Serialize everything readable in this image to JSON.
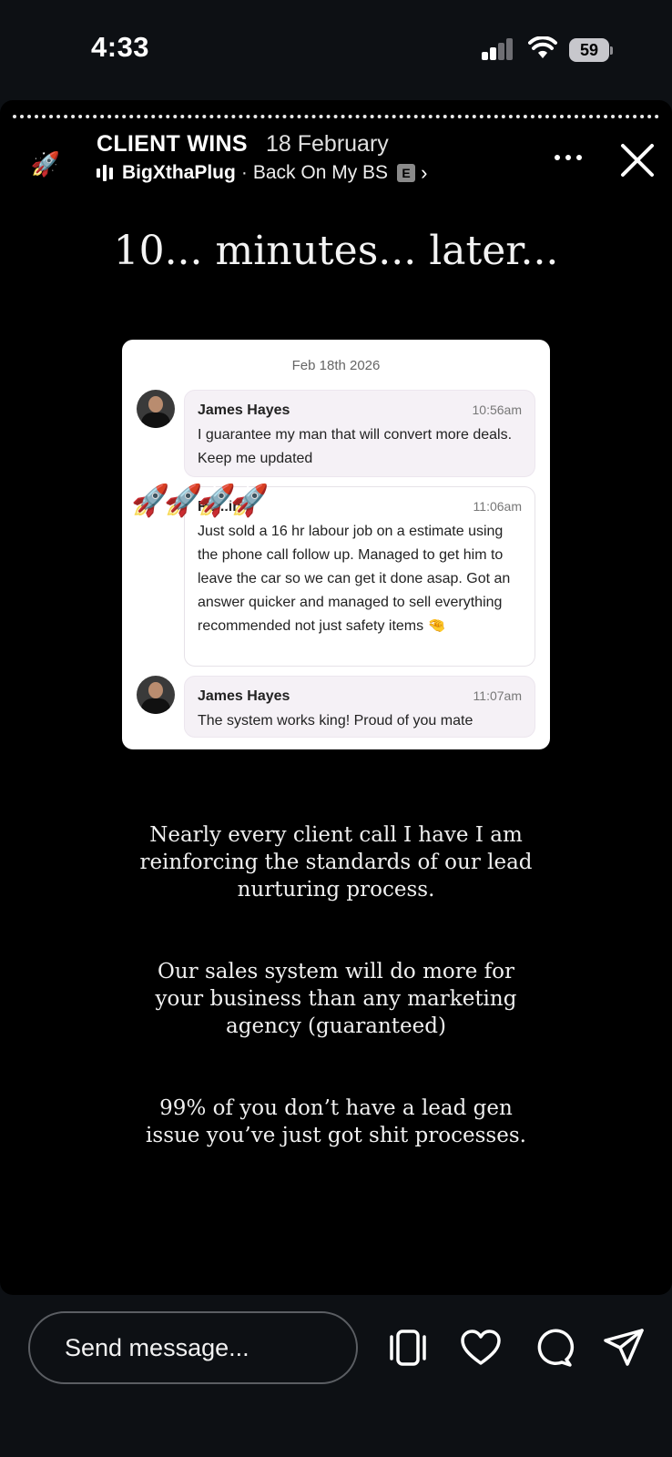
{
  "status_bar": {
    "time": "4:33",
    "battery": "59"
  },
  "story": {
    "avatar_emoji": "🚀",
    "title": "CLIENT WINS",
    "date": "18 February",
    "music": {
      "artist": "BigXthaPlug",
      "separator": "·",
      "song": "Back On My BS",
      "explicit_badge": "E",
      "chevron": "›"
    },
    "headline": "10... minutes... later...",
    "card": {
      "date": "Feb 18th 2026",
      "messages": [
        {
          "name": "James Hayes",
          "time": "10:56am",
          "text": "I guarantee my man that will convert more deals. Keep me updated"
        },
        {
          "name": "Re...in...",
          "time": "11:06am",
          "text": "Just sold a 16 hr labour job on a estimate using the phone call follow up. Managed to get him to leave the car so we can get it done asap. Got an answer quicker and managed to sell everything recommended not just safety items 🤏"
        },
        {
          "name": "James Hayes",
          "time": "11:07am",
          "text": "The system works king! Proud of you mate"
        }
      ],
      "rocket_stickers": "🚀🚀🚀🚀"
    },
    "caption": [
      "Nearly every client call I have I am reinforcing the standards of our lead nurturing process.",
      "Our sales system will do more for your business than any marketing agency (guaranteed)",
      "99% of you don’t have a lead gen issue you’ve just got shit processes."
    ]
  },
  "bottom_bar": {
    "message_placeholder": "Send message..."
  }
}
